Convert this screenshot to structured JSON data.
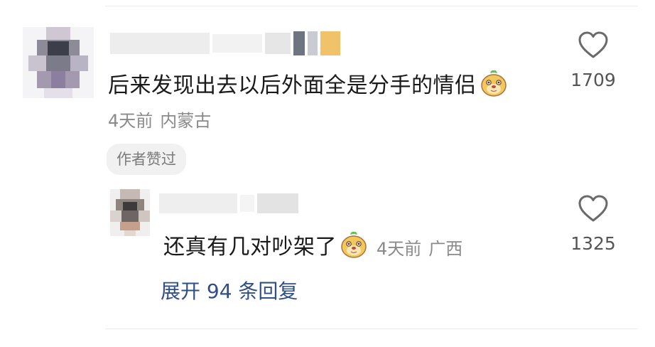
{
  "comment": {
    "avatar": "blurred-user-avatar",
    "username": "",
    "text": "后来发现出去以后外面全是分手的情侣",
    "emoji": "mole-face-emoji",
    "time": "4天前",
    "location": "内蒙古",
    "author_badge": "作者赞过",
    "like_count": "1709"
  },
  "reply": {
    "avatar": "blurred-user-avatar",
    "username": "",
    "text": "还真有几对吵架了",
    "emoji": "mole-face-emoji",
    "time": "4天前",
    "location": "广西",
    "like_count": "1325"
  },
  "expand_replies": "展开 94 条回复",
  "colors": {
    "link": "#2f4f86",
    "meta": "#8a8a8a",
    "badge_bg": "#f1f1f1"
  }
}
